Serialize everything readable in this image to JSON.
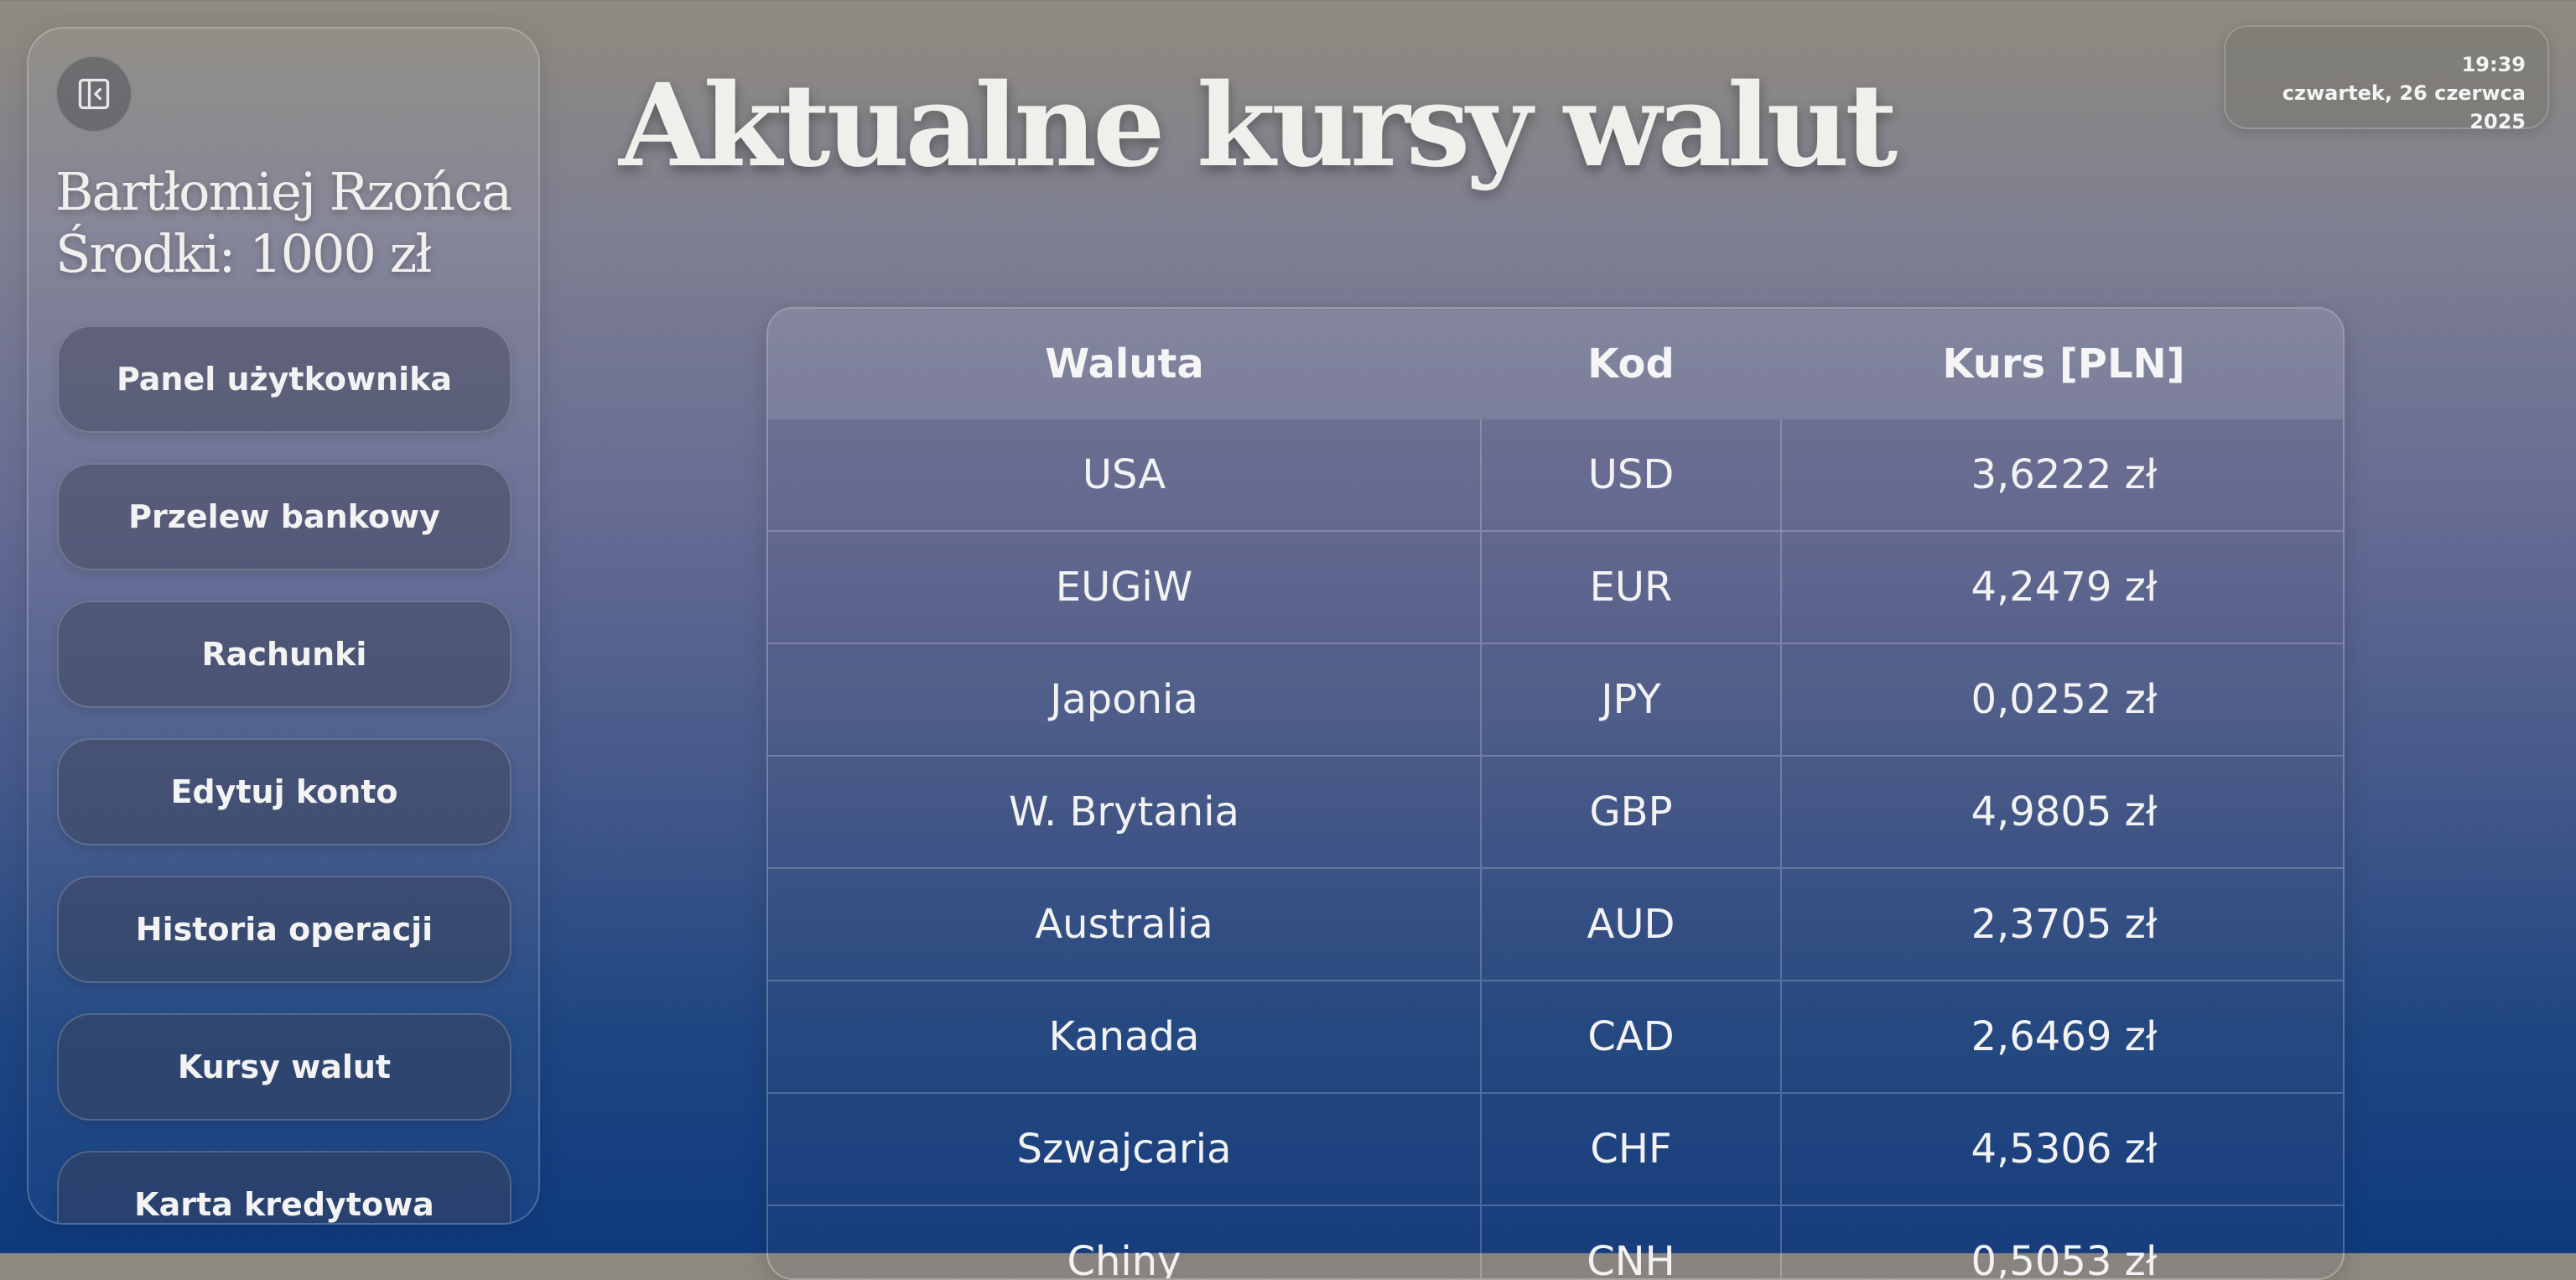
{
  "sidebar": {
    "user_name": "Bartłomiej Rzońca",
    "balance": "Środki: 1000 zł",
    "items": [
      {
        "label": "Panel użytkownika"
      },
      {
        "label": "Przelew bankowy"
      },
      {
        "label": "Rachunki"
      },
      {
        "label": "Edytuj konto"
      },
      {
        "label": "Historia operacji"
      },
      {
        "label": "Kursy walut"
      },
      {
        "label": "Karta kredytowa"
      }
    ],
    "collapse_icon": "sidebar-collapse-icon"
  },
  "header": {
    "title": "Aktualne kursy walut"
  },
  "clock": {
    "time": "19:39",
    "date": "czwartek, 26 czerwca 2025"
  },
  "table": {
    "columns": [
      "Waluta",
      "Kod",
      "Kurs [PLN]"
    ],
    "rows": [
      [
        "USA",
        "USD",
        "3,6222 zł"
      ],
      [
        "EUGiW",
        "EUR",
        "4,2479 zł"
      ],
      [
        "Japonia",
        "JPY",
        "0,0252 zł"
      ],
      [
        "W. Brytania",
        "GBP",
        "4,9805 zł"
      ],
      [
        "Australia",
        "AUD",
        "2,3705 zł"
      ],
      [
        "Kanada",
        "CAD",
        "2,6469 zł"
      ],
      [
        "Szwajcaria",
        "CHF",
        "4,5306 zł"
      ],
      [
        "Chiny",
        "CNH",
        "0,5053 zł"
      ]
    ]
  }
}
